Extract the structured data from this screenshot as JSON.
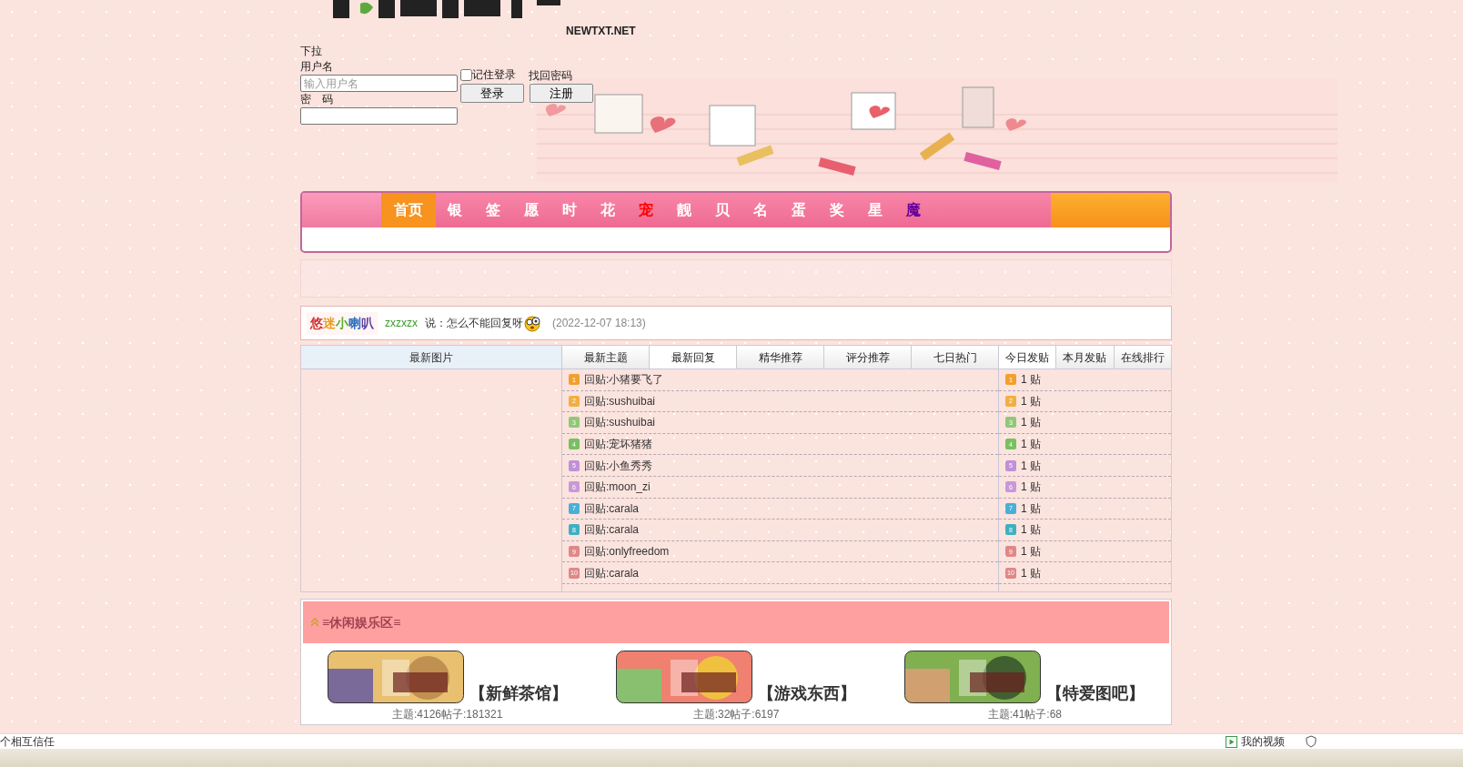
{
  "logo": {
    "domain": "NEWTXT.NET"
  },
  "login": {
    "dropdown": "下拉",
    "username_label": "用户名",
    "username_placeholder": "输入用户名",
    "password_label": "密　码",
    "remember": {
      "label": "记住登录",
      "checked": false
    },
    "forgot": "找回密码",
    "login_button": "登录",
    "register_button": "注册"
  },
  "nav": [
    {
      "label": "首页",
      "selected": true,
      "color": "#ffffff"
    },
    {
      "label": "银",
      "selected": false,
      "color": "#ffffff"
    },
    {
      "label": "签",
      "selected": false,
      "color": "#ffffff"
    },
    {
      "label": "愿",
      "selected": false,
      "color": "#ffffff"
    },
    {
      "label": "时",
      "selected": false,
      "color": "#ffffff"
    },
    {
      "label": "花",
      "selected": false,
      "color": "#ffffff"
    },
    {
      "label": "宠",
      "selected": false,
      "color": "#ff0000"
    },
    {
      "label": "靓",
      "selected": false,
      "color": "#ffffff"
    },
    {
      "label": "贝",
      "selected": false,
      "color": "#ffffff"
    },
    {
      "label": "名",
      "selected": false,
      "color": "#ffffff"
    },
    {
      "label": "蛋",
      "selected": false,
      "color": "#ffffff"
    },
    {
      "label": "奖",
      "selected": false,
      "color": "#ffffff"
    },
    {
      "label": "星",
      "selected": false,
      "color": "#ffffff"
    },
    {
      "label": "魔",
      "selected": false,
      "color": "#660099"
    }
  ],
  "shoutbox": {
    "logo": "悠迷小喇叭",
    "user": "zxzxzx",
    "message": "说：怎么不能回复呀",
    "time": "(2022-12-07 18:13)"
  },
  "pictures_tab": "最新图片",
  "thread_tabs": [
    {
      "label": "最新主题",
      "selected": false
    },
    {
      "label": "最新回复",
      "selected": true
    },
    {
      "label": "精华推荐",
      "selected": false
    },
    {
      "label": "评分推荐",
      "selected": false
    },
    {
      "label": "七日热门",
      "selected": false
    }
  ],
  "rank_tabs": [
    {
      "label": "今日发贴",
      "selected": true
    },
    {
      "label": "本月发贴",
      "selected": false
    },
    {
      "label": "在线排行",
      "selected": false
    }
  ],
  "threads": [
    {
      "number": "1",
      "color": "#f0a030",
      "title": "回贴:小猪要飞了"
    },
    {
      "number": "2",
      "color": "#f0b040",
      "title": "回贴:sushuibai"
    },
    {
      "number": "3",
      "color": "#90c878",
      "title": "回贴:sushuibai"
    },
    {
      "number": "4",
      "color": "#78c060",
      "title": "回贴:宠坏猪猪"
    },
    {
      "number": "5",
      "color": "#c090d8",
      "title": "回贴:小鱼秀秀"
    },
    {
      "number": "6",
      "color": "#c898d8",
      "title": "回贴:moon_zi"
    },
    {
      "number": "7",
      "color": "#48b0d8",
      "title": "回贴:carala"
    },
    {
      "number": "8",
      "color": "#40b0c0",
      "title": "回贴:carala"
    },
    {
      "number": "9",
      "color": "#e08888",
      "title": "回贴:onlyfreedom"
    },
    {
      "number": "10",
      "color": "#e08888",
      "title": "回贴:carala"
    }
  ],
  "ranks": [
    {
      "number": "1",
      "color": "#f0a030",
      "count": "1 贴"
    },
    {
      "number": "2",
      "color": "#f0b040",
      "count": "1 贴"
    },
    {
      "number": "3",
      "color": "#90c878",
      "count": "1 贴"
    },
    {
      "number": "4",
      "color": "#78c060",
      "count": "1 贴"
    },
    {
      "number": "5",
      "color": "#c090d8",
      "count": "1 贴"
    },
    {
      "number": "6",
      "color": "#c898d8",
      "count": "1 贴"
    },
    {
      "number": "7",
      "color": "#48b0d8",
      "count": "1 贴"
    },
    {
      "number": "8",
      "color": "#40b0c0",
      "count": "1 贴"
    },
    {
      "number": "9",
      "color": "#e08888",
      "count": "1 贴"
    },
    {
      "number": "10",
      "color": "#e08888",
      "count": "1 贴"
    }
  ],
  "section": {
    "title": "≡休闲娱乐区≡",
    "boards": [
      {
        "name": "【新鲜茶馆】",
        "stats": "主题:4126帖子:181321"
      },
      {
        "name": "【游戏东西】",
        "stats": "主题:32帖子:6197"
      },
      {
        "name": "【特爱图吧】",
        "stats": "主题:41帖子:68"
      }
    ]
  },
  "status_bar": {
    "left": "个相互信任",
    "video": "我的视频"
  }
}
